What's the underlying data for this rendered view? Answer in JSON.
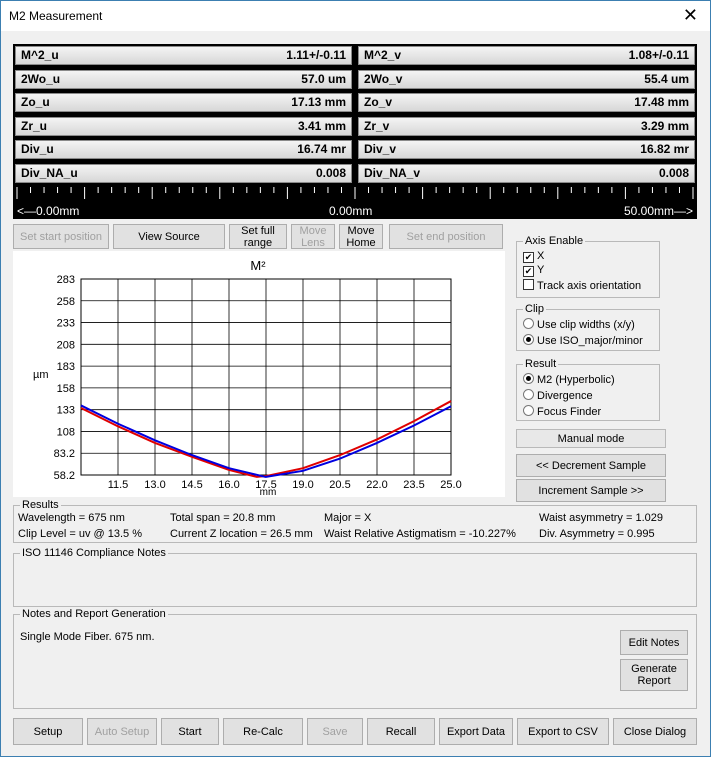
{
  "window": {
    "title": "M2 Measurement",
    "close_glyph": "✕"
  },
  "metrics_u": [
    {
      "label": "M^2_u",
      "value": "1.11+/-0.11"
    },
    {
      "label": "2Wo_u",
      "value": "57.0 um"
    },
    {
      "label": "Zo_u",
      "value": "17.13 mm"
    },
    {
      "label": "Zr_u",
      "value": "3.41 mm"
    },
    {
      "label": "Div_u",
      "value": "16.74 mr"
    },
    {
      "label": "Div_NA_u",
      "value": "0.008"
    }
  ],
  "metrics_v": [
    {
      "label": "M^2_v",
      "value": "1.08+/-0.11"
    },
    {
      "label": "2Wo_v",
      "value": "55.4 um"
    },
    {
      "label": "Zo_v",
      "value": "17.48 mm"
    },
    {
      "label": "Zr_v",
      "value": "3.29 mm"
    },
    {
      "label": "Div_v",
      "value": "16.82 mr"
    },
    {
      "label": "Div_NA_v",
      "value": "0.008"
    }
  ],
  "ruler": {
    "left": "<—0.00mm",
    "center": "0.00mm",
    "right": "50.00mm—>"
  },
  "toolbar": {
    "set_start": "Set start position",
    "view_source": "View Source",
    "set_full_range": "Set full range",
    "move_lens": "Move Lens",
    "move_home": "Move Home",
    "set_end": "Set end position"
  },
  "axis_enable": {
    "title": "Axis Enable",
    "x": "X",
    "y": "Y",
    "track": "Track axis orientation",
    "x_checked": true,
    "y_checked": true,
    "track_checked": false
  },
  "clip": {
    "title": "Clip",
    "opt1": "Use clip widths (x/y)",
    "opt2": "Use ISO_major/minor",
    "selected": 2
  },
  "result": {
    "title": "Result",
    "opt1": "M2 (Hyperbolic)",
    "opt2": "Divergence",
    "opt3": "Focus Finder",
    "selected": 1
  },
  "side": {
    "manual_mode": "Manual mode",
    "decrement": "<< Decrement Sample",
    "increment": "Increment Sample >>"
  },
  "results": {
    "title": "Results",
    "wavelength": "Wavelength = 675 nm",
    "clip_level": "Clip Level = uv @ 13.5 %",
    "total_span": "Total span = 20.8 mm",
    "current_z": "Current Z location  = 26.5 mm",
    "major": "Major = X",
    "waist_astig": "Waist Relative Astigmatism = -10.227%",
    "waist_asym": "Waist asymmetry = 1.029",
    "div_asym": "Div. Asymmetry = 0.995"
  },
  "iso": {
    "title": "ISO 11146 Compliance Notes"
  },
  "notes": {
    "title": "Notes and Report Generation",
    "text": "Single Mode Fiber. 675 nm.",
    "edit": "Edit Notes",
    "generate": "Generate Report"
  },
  "bottom": {
    "setup": "Setup",
    "auto_setup": "Auto Setup",
    "start": "Start",
    "recalc": "Re-Calc",
    "save": "Save",
    "recall": "Recall",
    "export_data": "Export Data",
    "export_csv": "Export to CSV",
    "close": "Close Dialog"
  },
  "chart_data": {
    "type": "line",
    "title": "M²",
    "xlabel": "mm",
    "ylabel": "µm",
    "xlim": [
      10.0,
      25.0
    ],
    "ylim": [
      58.2,
      283
    ],
    "x_ticks": [
      "11.5",
      "13.0",
      "14.5",
      "16.0",
      "17.5",
      "19.0",
      "20.5",
      "22.0",
      "23.5",
      "25.0"
    ],
    "y_ticks": [
      "283",
      "258",
      "233",
      "208",
      "183",
      "158",
      "133",
      "108",
      "83.2",
      "58.2"
    ],
    "grid": true,
    "series": [
      {
        "color": "#e00000",
        "x": [
          10.0,
          11.5,
          13.0,
          14.5,
          16.0,
          17.13,
          17.5,
          19.0,
          20.5,
          22.0,
          23.5,
          25.0
        ],
        "y": [
          135,
          114,
          95,
          79,
          64,
          56,
          57,
          66,
          81,
          99,
          120,
          143
        ]
      },
      {
        "color": "#0000e0",
        "x": [
          10.0,
          11.5,
          13.0,
          14.5,
          16.0,
          17.48,
          17.5,
          19.0,
          20.5,
          22.0,
          23.5,
          25.0
        ],
        "y": [
          138,
          117,
          98,
          81,
          66,
          56,
          56,
          63,
          77,
          95,
          115,
          137
        ]
      }
    ]
  }
}
